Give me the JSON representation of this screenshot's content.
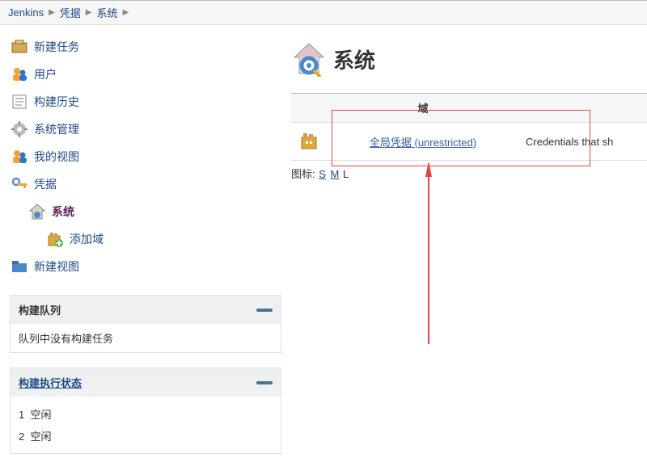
{
  "breadcrumb": [
    {
      "label": "Jenkins"
    },
    {
      "label": "凭据"
    },
    {
      "label": "系统"
    }
  ],
  "sidebar": {
    "items": [
      {
        "label": "新建任务",
        "icon": "new-job-icon"
      },
      {
        "label": "用户",
        "icon": "people-icon"
      },
      {
        "label": "构建历史",
        "icon": "history-icon"
      },
      {
        "label": "系统管理",
        "icon": "gear-icon"
      },
      {
        "label": "我的视图",
        "icon": "myview-icon"
      },
      {
        "label": "凭据",
        "icon": "credentials-icon"
      }
    ],
    "credentials_children": [
      {
        "label": "系统",
        "icon": "system-icon",
        "active": true
      },
      {
        "sub": true,
        "label": "添加域",
        "icon": "add-domain-icon"
      }
    ],
    "last": {
      "label": "新建视图",
      "icon": "folder-icon"
    }
  },
  "build_queue": {
    "title": "构建队列",
    "empty": "队列中没有构建任务"
  },
  "executors": {
    "title": "构建执行状态",
    "items": [
      {
        "num": "1",
        "state": "空闲"
      },
      {
        "num": "2",
        "state": "空闲"
      }
    ]
  },
  "page": {
    "title": "系统"
  },
  "table": {
    "header_domain": "域",
    "row": {
      "link": "全局凭据 (unrestricted)",
      "desc": "Credentials that sh"
    }
  },
  "legend": {
    "prefix": "图标:",
    "s": "S",
    "m": "M",
    "l": "L"
  }
}
